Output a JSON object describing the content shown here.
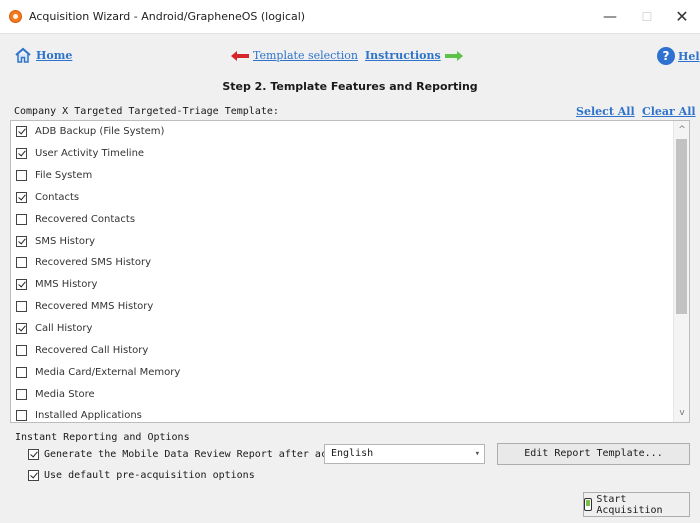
{
  "window": {
    "title": "Acquisition Wizard - Android/GrapheneOS (logical)",
    "minimize": "—",
    "maximize": "☐",
    "close": "✕"
  },
  "nav": {
    "home": "Home",
    "prev": "Template selection",
    "next": "Instructions",
    "help": "Help",
    "colors": {
      "link": "#2e73c9",
      "prev_arrow": "#d6262c",
      "next_arrow": "#5cc249"
    }
  },
  "step_title": "Step 2. Template Features and Reporting",
  "template": {
    "name": "Company X Targeted Targeted-Triage Template:",
    "select_all": "Select All",
    "clear_all": "Clear All"
  },
  "features": [
    {
      "label": "ADB Backup (File System)",
      "checked": true
    },
    {
      "label": "User Activity Timeline",
      "checked": true
    },
    {
      "label": "File System",
      "checked": false
    },
    {
      "label": "Contacts",
      "checked": true
    },
    {
      "label": "Recovered Contacts",
      "checked": false
    },
    {
      "label": "SMS History",
      "checked": true
    },
    {
      "label": "Recovered SMS History",
      "checked": false
    },
    {
      "label": "MMS History",
      "checked": true
    },
    {
      "label": "Recovered MMS History",
      "checked": false
    },
    {
      "label": "Call History",
      "checked": true
    },
    {
      "label": "Recovered Call History",
      "checked": false
    },
    {
      "label": "Media Card/External Memory",
      "checked": false
    },
    {
      "label": "Media Store",
      "checked": false
    },
    {
      "label": "Installed Applications",
      "checked": false
    }
  ],
  "reporting": {
    "section_label": "Instant Reporting and Options",
    "generate_label": "Generate the Mobile Data Review Report after acquisition",
    "generate_checked": true,
    "language": "English",
    "edit_button": "Edit Report Template...",
    "default_label": "Use default pre-acquisition options",
    "default_checked": true
  },
  "start_button": "Start Acquisition"
}
